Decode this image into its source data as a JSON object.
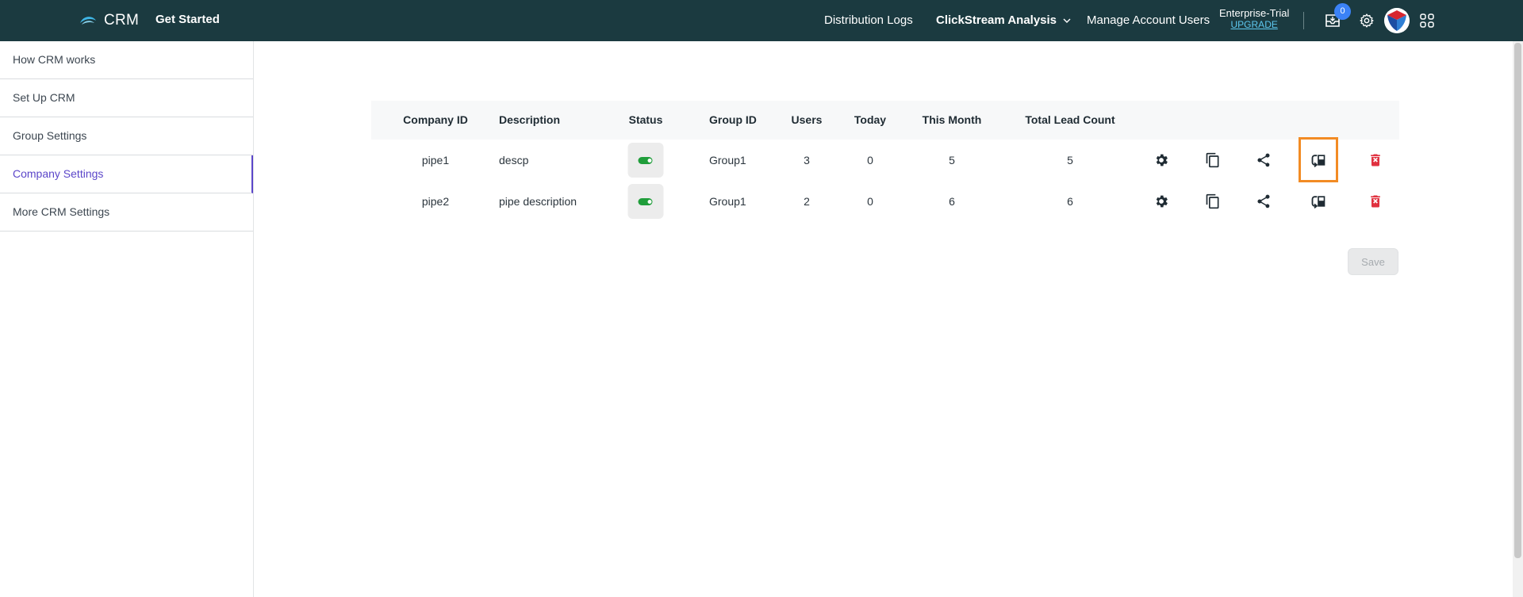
{
  "header": {
    "brand": "CRM",
    "get_started": "Get Started",
    "nav": {
      "distribution_logs": "Distribution Logs",
      "clickstream": "ClickStream Analysis",
      "manage_users": "Manage Account Users"
    },
    "plan": "Enterprise-Trial",
    "upgrade": "UPGRADE",
    "notification_count": "0",
    "icons": [
      "inbox-icon",
      "gear-icon",
      "avatar",
      "apps-grid-icon"
    ],
    "colors": {
      "bar": "#1b3a40",
      "badge": "#3b82f6",
      "upgrade": "#5ec8f0"
    }
  },
  "sidebar": {
    "items": [
      {
        "label": "How CRM works"
      },
      {
        "label": "Set Up CRM"
      },
      {
        "label": "Group Settings"
      },
      {
        "label": "Company Settings",
        "active": true
      },
      {
        "label": "More CRM Settings"
      }
    ],
    "active_color": "#5b46c9"
  },
  "table": {
    "columns": [
      "Company ID",
      "Description",
      "Status",
      "Group ID",
      "Users",
      "Today",
      "This Month",
      "Total Lead Count"
    ],
    "rows": [
      {
        "company_id": "pipe1",
        "description": "descp",
        "status": "on",
        "group_id": "Group1",
        "users": "3",
        "today": "0",
        "this_month": "5",
        "total": "5"
      },
      {
        "company_id": "pipe2",
        "description": "pipe description",
        "status": "on",
        "group_id": "Group1",
        "users": "2",
        "today": "0",
        "this_month": "6",
        "total": "6"
      }
    ],
    "row_actions": [
      "settings-icon",
      "copy-icon",
      "share-icon",
      "reassign-icon",
      "delete-icon"
    ],
    "highlighted_action": "reassign-icon (row 1)",
    "colors": {
      "toggle_on": "#1f9d3a",
      "delete": "#e0313f",
      "highlight": "#f28b24"
    }
  },
  "save_label": "Save"
}
